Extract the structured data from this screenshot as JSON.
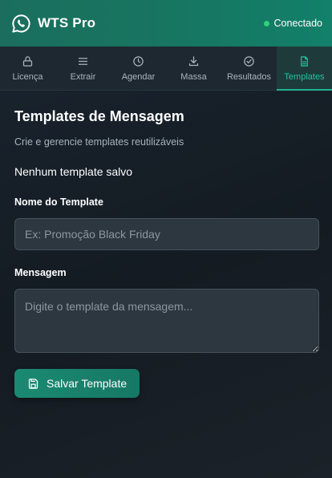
{
  "app": {
    "title": "WTS Pro",
    "logo_icon": "whatsapp-icon",
    "status_text": "Conectado",
    "status_color": "#2fd27a",
    "accent_color": "#1b8a72"
  },
  "tabs": [
    {
      "label": "Licença",
      "icon": "lock-icon",
      "active": false
    },
    {
      "label": "Extrair",
      "icon": "menu-icon",
      "active": false
    },
    {
      "label": "Agendar",
      "icon": "clock-icon",
      "active": false
    },
    {
      "label": "Massa",
      "icon": "download-icon",
      "active": false
    },
    {
      "label": "Resultados",
      "icon": "check-circle-icon",
      "active": false
    },
    {
      "label": "Templates",
      "icon": "document-icon",
      "active": true
    }
  ],
  "main": {
    "title": "Templates de Mensagem",
    "subtitle": "Crie e gerencie templates reutilizáveis",
    "empty_message": "Nenhum template salvo",
    "name_label": "Nome do Template",
    "name_placeholder": "Ex: Promoção Black Friday",
    "name_value": "",
    "message_label": "Mensagem",
    "message_placeholder": "Digite o template da mensagem...",
    "message_value": "",
    "save_label": "Salvar Template",
    "save_icon": "save-icon"
  }
}
